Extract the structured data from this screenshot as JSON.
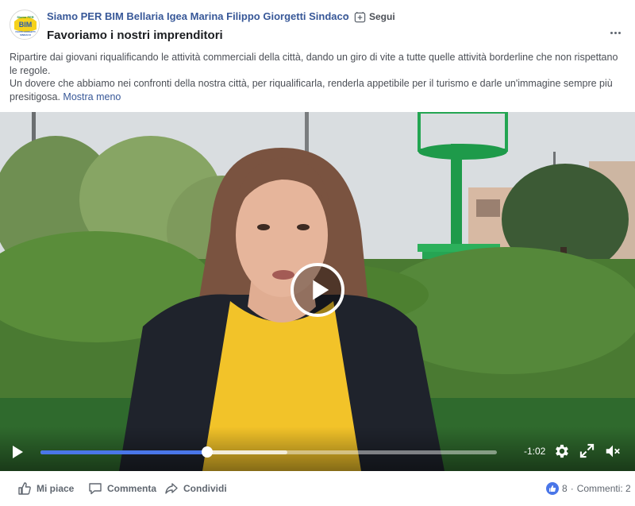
{
  "header": {
    "page_name": "Siamo PER BIM Bellaria Igea Marina Filippo Giorgetti Sindaco",
    "separator": "·",
    "follow_label": "Segui",
    "post_title": "Favoriamo i nostri imprenditori",
    "avatar_text": {
      "top": "Siamo PER",
      "logo": "BIM",
      "line1": "FILIPPO GIORGETTI",
      "line2": "SINDACO"
    }
  },
  "post": {
    "paragraph1": "Ripartire dai giovani riqualificando le attività commerciali della città, dando un giro di vite a tutte quelle attività borderline che non rispettano le regole.",
    "paragraph2": "Un dovere che abbiamo nei confronti della nostra città, per riqualificarla, renderla appetibile per il turismo e darle un'immagine sempre più presitigosa.",
    "see_more": "Mostra meno"
  },
  "video": {
    "time_remaining": "-1:02",
    "progress_fraction": 0.365,
    "buffered_fraction": 0.54
  },
  "actions": {
    "like_label": "Mi piace",
    "comment_label": "Commenta",
    "share_label": "Condividi",
    "reaction_count": "8",
    "comments_label": "Commenti: 2"
  },
  "colors": {
    "link": "#385898",
    "progress": "#4a76e8",
    "like_badge": "#4a76e8"
  }
}
